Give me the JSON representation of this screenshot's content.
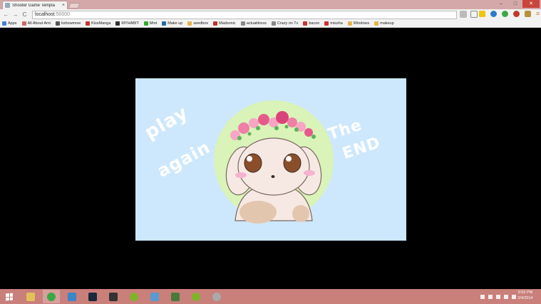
{
  "window": {
    "tab_title": "Shooter Game Templa",
    "tab_close": "×",
    "min": "–",
    "max": "□",
    "close": "✕"
  },
  "toolbar": {
    "back": "←",
    "forward": "→",
    "reload": "C",
    "url_host": "localhost",
    "url_port": ":50000"
  },
  "bookmarks": [
    {
      "label": "Apps",
      "icon": "apps-grid-icon",
      "color": "#4a7fd1"
    },
    {
      "label": "All About Ami",
      "icon": "page-icon",
      "color": "#c66"
    },
    {
      "label": "kshowmow",
      "icon": "page-icon",
      "color": "#555"
    },
    {
      "label": "KissManga",
      "icon": "page-icon",
      "color": "#c33"
    },
    {
      "label": "MYHABIT",
      "icon": "page-icon",
      "color": "#333"
    },
    {
      "label": "Mint",
      "icon": "leaf-icon",
      "color": "#3a3"
    },
    {
      "label": "Make up",
      "icon": "wordpress-icon",
      "color": "#2a6aa0"
    },
    {
      "label": "seedbox",
      "icon": "folder-icon",
      "color": "#e3b54a"
    },
    {
      "label": "Madsonic",
      "icon": "page-icon",
      "color": "#b33"
    },
    {
      "label": "actualdress",
      "icon": "page-icon",
      "color": "#888"
    },
    {
      "label": "Crazy on Tv",
      "icon": "page-icon",
      "color": "#888"
    },
    {
      "label": "bacon",
      "icon": "page-icon",
      "color": "#c33"
    },
    {
      "label": "missha",
      "icon": "page-icon",
      "color": "#c33"
    },
    {
      "label": "Windows",
      "icon": "folder-icon",
      "color": "#e3b54a"
    },
    {
      "label": "makeup",
      "icon": "folder-icon",
      "color": "#e3b54a"
    }
  ],
  "game": {
    "play_text": "play",
    "again_text": "again",
    "the_text": "The",
    "end_text": "END",
    "bg_color": "#cde8fc",
    "circle_color": "#d9f3b8"
  },
  "clock": {
    "time": "9:52 PM",
    "date": "2/4/2014"
  }
}
